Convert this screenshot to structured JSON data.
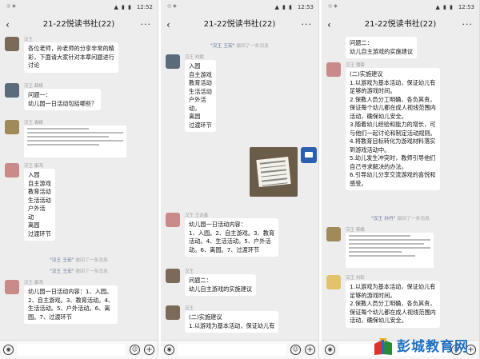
{
  "phones": [
    {
      "status_left": "◎ ◆",
      "status_signal": "▲ ▮ ▮",
      "time": "12:52",
      "back_icon": "‹",
      "title": "21-22悦读书社(22)",
      "more_icon": "···",
      "messages": [
        {
          "sender": "汉王 ",
          "text": "各位老师，孙老师的分享非常的精\n彩，下面请大家针对本章问题进行\n讨论"
        },
        {
          "sender": "汉王 薛婧",
          "text": "问题一：\n幼儿园一日活动包括哪些？"
        },
        {
          "sender": "汉王 袁婧",
          "text": ""
        },
        {
          "sender": "汉王 康鸿",
          "text": "入园\n自主游戏\n教育活动\n生活活动\n户外活\n动\n离园\n过渡环节"
        },
        {
          "system": true,
          "who": "\"汉王 王宏\"",
          "action": " 撤回了一条消息"
        },
        {
          "system": true,
          "who": "\"汉王 王宏\"",
          "action": " 撤回了一条消息"
        },
        {
          "sender": "汉王 康鸿",
          "text": "幼儿园一日活动内容：1、入园。\n2、自主游戏。3、教育活动。4、\n生活活动。5、户外活动。6、离\n园。7、过渡环节"
        }
      ]
    },
    {
      "status_left": "◎ ◆",
      "status_signal": "▲ ▮ ▮",
      "time": "12:53",
      "back_icon": "‹",
      "title": "21-22悦读书社(22)",
      "more_icon": "···",
      "messages": [
        {
          "system": true,
          "who": "\"汉王 王宏\"",
          "action": " 撤回了一条消息"
        },
        {
          "sender": "汉王 刘斌",
          "text": "入园\n自主游戏\n教育活动\n生活活动\n户外活\n动，\n离园\n过渡环节"
        },
        {
          "sender": "汉王 王达鑫",
          "text": "幼儿园一日活动内容：\n1、入园。2、自主游戏。3、教育\n活动。4、生活活动。5、户外活\n动。6、离园。7、过渡环节"
        },
        {
          "sender": "汉王 ",
          "text": "问题二：\n幼儿自主游戏的实施建议"
        },
        {
          "sender": "汉王 ",
          "text": "(二)实施建议\n1.以游戏为基本活动，保证幼儿有"
        }
      ]
    },
    {
      "status_left": "◎ ◆",
      "status_signal": "▲ ▮ ▮",
      "time": "12:53",
      "back_icon": "‹",
      "title": "21-22悦读书社(22)",
      "more_icon": "···",
      "messages": [
        {
          "sender": "",
          "text": "问题二：\n幼儿自主游戏的实施建议"
        },
        {
          "sender": "汉王 蒲菊",
          "text": "(二)实施建议\n1.以游戏为基本活动，保证幼儿有\n足够的游戏时间。\n2.保教人员分工明确，各负其责，\n保证每个幼儿都在成人视线范围内\n活动，确保幼儿安全。\n3.随着幼儿经验和能力的增长，可\n与他们一起讨论和制定活动规则。\n4.将教育目标转化为游戏材料落实\n到游戏活动中。\n5.幼儿发生冲突时，教师引导他们\n自己寻求解决的办法。\n6.引导幼儿分享交流游戏的喜悦和\n感受。"
        },
        {
          "system": true,
          "who": "\"汉王 孙丹\"",
          "action": " 撤回了一条消息"
        },
        {
          "sender": "汉王 蒋婧",
          "text": ""
        },
        {
          "sender": "汉王 刘彩",
          "text": "1.以游戏为基本活动，保证幼儿有\n足够的游戏时间。\n2.保教人员分工明确，各负其责，\n保证每个幼儿都在成人视线范围内\n活动，确保幼儿安全。"
        }
      ]
    }
  ],
  "input_icons": {
    "voice": "◉",
    "emoji": "☺",
    "plus": "+"
  },
  "watermark": "彭城教育网"
}
